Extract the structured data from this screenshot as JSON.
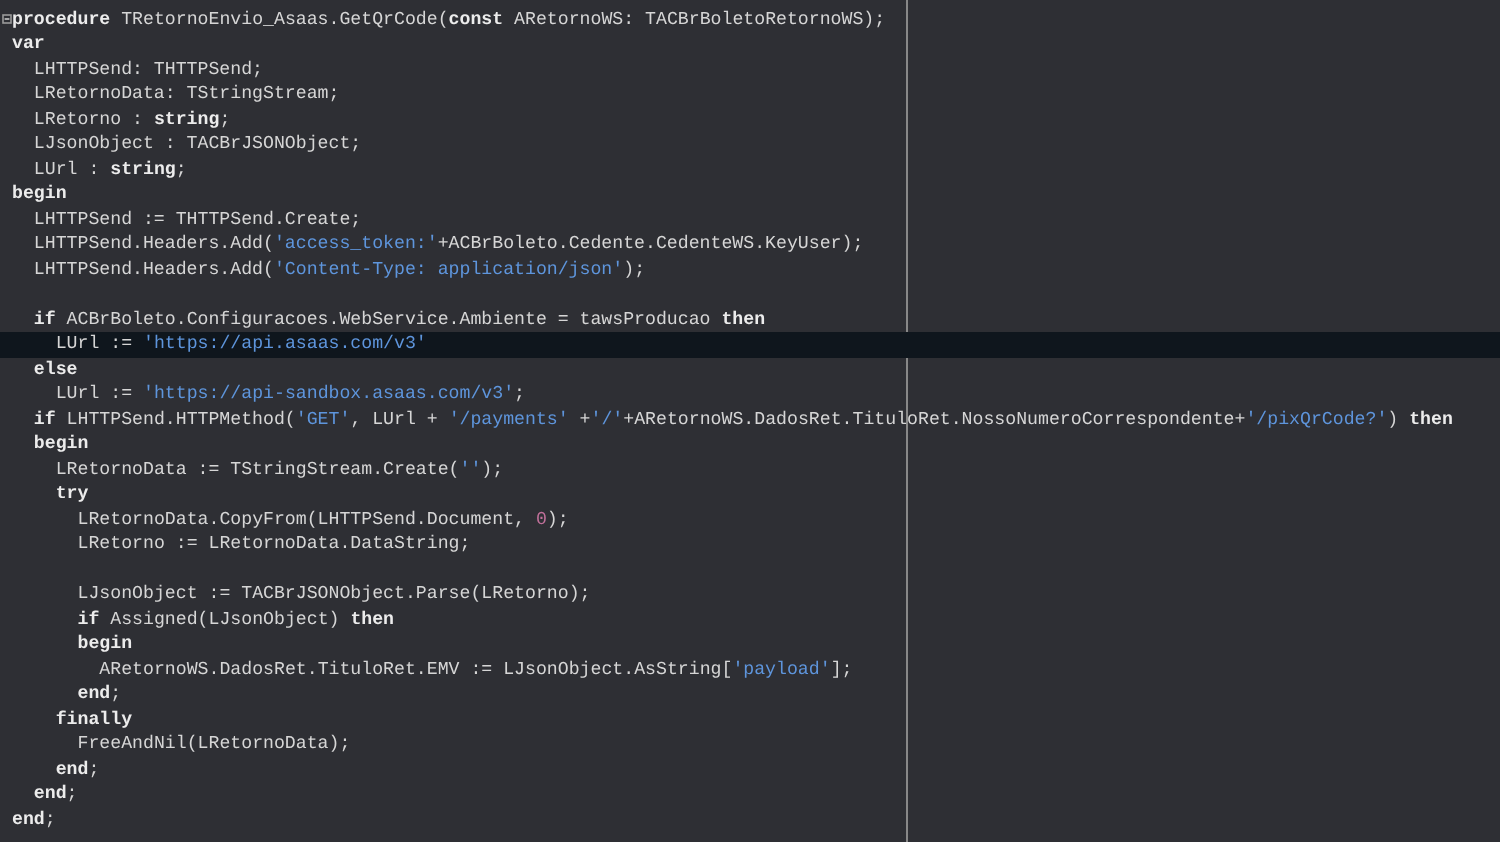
{
  "editor": {
    "lines": [
      {
        "fold": true,
        "current": false,
        "tokens": [
          {
            "kind": "keyword",
            "text": "procedure"
          },
          {
            "kind": "plain",
            "text": " TRetornoEnvio_Asaas.GetQrCode("
          },
          {
            "kind": "keyword",
            "text": "const"
          },
          {
            "kind": "plain",
            "text": " ARetornoWS: TACBrBoletoRetornoWS);"
          }
        ]
      },
      {
        "fold": false,
        "current": false,
        "tokens": [
          {
            "kind": "keyword",
            "text": "var"
          }
        ],
        "children": [
          {
            "fold": false,
            "current": false,
            "tokens": [
              {
                "kind": "plain",
                "text": "LHTTPSend: THTTPSend;"
              }
            ]
          },
          {
            "fold": false,
            "current": false,
            "tokens": [
              {
                "kind": "plain",
                "text": "LRetornoData: TStringStream;"
              }
            ]
          },
          {
            "fold": false,
            "current": false,
            "tokens": [
              {
                "kind": "plain",
                "text": "LRetorno : "
              },
              {
                "kind": "keyword",
                "text": "string"
              },
              {
                "kind": "plain",
                "text": ";"
              }
            ]
          },
          {
            "fold": false,
            "current": false,
            "tokens": [
              {
                "kind": "plain",
                "text": "LJsonObject : TACBrJSONObject;"
              }
            ]
          },
          {
            "fold": false,
            "current": false,
            "tokens": [
              {
                "kind": "plain",
                "text": "LUrl : "
              },
              {
                "kind": "keyword",
                "text": "string"
              },
              {
                "kind": "plain",
                "text": ";"
              }
            ]
          }
        ]
      },
      {
        "fold": false,
        "current": false,
        "tokens": [
          {
            "kind": "keyword",
            "text": "begin"
          }
        ],
        "children": [
          {
            "fold": false,
            "current": false,
            "tokens": [
              {
                "kind": "plain",
                "text": "LHTTPSend := THTTPSend.Create;"
              }
            ]
          },
          {
            "fold": false,
            "current": false,
            "tokens": [
              {
                "kind": "plain",
                "text": "LHTTPSend.Headers.Add("
              },
              {
                "kind": "string",
                "text": "'access_token:'"
              },
              {
                "kind": "plain",
                "text": "+ACBrBoleto.Cedente.CedenteWS.KeyUser);"
              }
            ]
          },
          {
            "fold": false,
            "current": false,
            "tokens": [
              {
                "kind": "plain",
                "text": "LHTTPSend.Headers.Add("
              },
              {
                "kind": "string",
                "text": "'Content-Type: application/json'"
              },
              {
                "kind": "plain",
                "text": ");"
              }
            ]
          },
          {
            "fold": false,
            "current": false
          },
          {
            "fold": false,
            "current": false,
            "tokens": [
              {
                "kind": "keyword",
                "text": "if"
              },
              {
                "kind": "plain",
                "text": " ACBrBoleto.Configuracoes.WebService.Ambiente = tawsProducao "
              },
              {
                "kind": "keyword",
                "text": "then"
              }
            ],
            "children": [
              {
                "fold": false,
                "current": true,
                "tokens": [
                  {
                    "kind": "plain",
                    "text": "LUrl := "
                  },
                  {
                    "kind": "string",
                    "text": "'https://api.asaas.com/v3'"
                  }
                ]
              }
            ]
          },
          {
            "fold": false,
            "current": false,
            "tokens": [
              {
                "kind": "keyword",
                "text": "else"
              }
            ],
            "children": [
              {
                "fold": false,
                "current": false,
                "tokens": [
                  {
                    "kind": "plain",
                    "text": "LUrl := "
                  },
                  {
                    "kind": "string",
                    "text": "'https://api-sandbox.asaas.com/v3'"
                  },
                  {
                    "kind": "plain",
                    "text": ";"
                  }
                ]
              }
            ]
          },
          {
            "fold": false,
            "current": false,
            "tokens": [
              {
                "kind": "keyword",
                "text": "if"
              },
              {
                "kind": "plain",
                "text": " LHTTPSend.HTTPMethod("
              },
              {
                "kind": "string",
                "text": "'GET'"
              },
              {
                "kind": "plain",
                "text": ", LUrl + "
              },
              {
                "kind": "string",
                "text": "'/payments'"
              },
              {
                "kind": "plain",
                "text": " +"
              },
              {
                "kind": "string",
                "text": "'/'"
              },
              {
                "kind": "plain",
                "text": "+ARetornoWS.DadosRet.TituloRet.NossoNumeroCorrespondente+"
              },
              {
                "kind": "string",
                "text": "'/pixQrCode?'"
              },
              {
                "kind": "plain",
                "text": ") "
              },
              {
                "kind": "keyword",
                "text": "then"
              }
            ]
          },
          {
            "fold": false,
            "current": false,
            "tokens": [
              {
                "kind": "keyword",
                "text": "begin"
              }
            ],
            "children": [
              {
                "fold": false,
                "current": false,
                "tokens": [
                  {
                    "kind": "plain",
                    "text": "LRetornoData := TStringStream.Create("
                  },
                  {
                    "kind": "string",
                    "text": "''"
                  },
                  {
                    "kind": "plain",
                    "text": ");"
                  }
                ]
              },
              {
                "fold": false,
                "current": false,
                "tokens": [
                  {
                    "kind": "keyword",
                    "text": "try"
                  }
                ],
                "children": [
                  {
                    "fold": false,
                    "current": false,
                    "tokens": [
                      {
                        "kind": "plain",
                        "text": "LRetornoData.CopyFrom(LHTTPSend.Document, "
                      },
                      {
                        "kind": "number",
                        "text": "0"
                      },
                      {
                        "kind": "plain",
                        "text": ");"
                      }
                    ]
                  },
                  {
                    "fold": false,
                    "current": false,
                    "tokens": [
                      {
                        "kind": "plain",
                        "text": "LRetorno := LRetornoData.DataString;"
                      }
                    ]
                  },
                  {
                    "fold": false,
                    "current": false
                  },
                  {
                    "fold": false,
                    "current": false,
                    "tokens": [
                      {
                        "kind": "plain",
                        "text": "LJsonObject := TACBrJSONObject.Parse(LRetorno);"
                      }
                    ]
                  },
                  {
                    "fold": false,
                    "current": false,
                    "tokens": [
                      {
                        "kind": "keyword",
                        "text": "if"
                      },
                      {
                        "kind": "plain",
                        "text": " Assigned(LJsonObject) "
                      },
                      {
                        "kind": "keyword",
                        "text": "then"
                      }
                    ]
                  },
                  {
                    "fold": false,
                    "current": false,
                    "tokens": [
                      {
                        "kind": "keyword",
                        "text": "begin"
                      }
                    ],
                    "children": [
                      {
                        "fold": false,
                        "current": false,
                        "tokens": [
                          {
                            "kind": "plain",
                            "text": "ARetornoWS.DadosRet.TituloRet.EMV := LJsonObject.AsString["
                          },
                          {
                            "kind": "string",
                            "text": "'payload'"
                          },
                          {
                            "kind": "plain",
                            "text": "];"
                          }
                        ]
                      }
                    ]
                  },
                  {
                    "fold": false,
                    "current": false,
                    "tokens": [
                      {
                        "kind": "keyword",
                        "text": "end"
                      },
                      {
                        "kind": "plain",
                        "text": ";"
                      }
                    ]
                  }
                ]
              },
              {
                "fold": false,
                "current": false,
                "tokens": [
                  {
                    "kind": "keyword",
                    "text": "finally"
                  }
                ],
                "children": [
                  {
                    "fold": false,
                    "current": false,
                    "tokens": [
                      {
                        "kind": "plain",
                        "text": "FreeAndNil(LRetornoData);"
                      }
                    ]
                  }
                ]
              },
              {
                "fold": false,
                "current": false,
                "tokens": [
                  {
                    "kind": "keyword",
                    "text": "end"
                  },
                  {
                    "kind": "plain",
                    "text": ";"
                  }
                ]
              }
            ]
          },
          {
            "fold": false,
            "current": false,
            "tokens": [
              {
                "kind": "keyword",
                "text": "end"
              },
              {
                "kind": "plain",
                "text": ";"
              }
            ]
          }
        ]
      },
      {
        "fold": false,
        "current": false,
        "tokens": [
          {
            "kind": "keyword",
            "text": "end"
          },
          {
            "kind": "plain",
            "text": ";"
          }
        ]
      }
    ]
  }
}
